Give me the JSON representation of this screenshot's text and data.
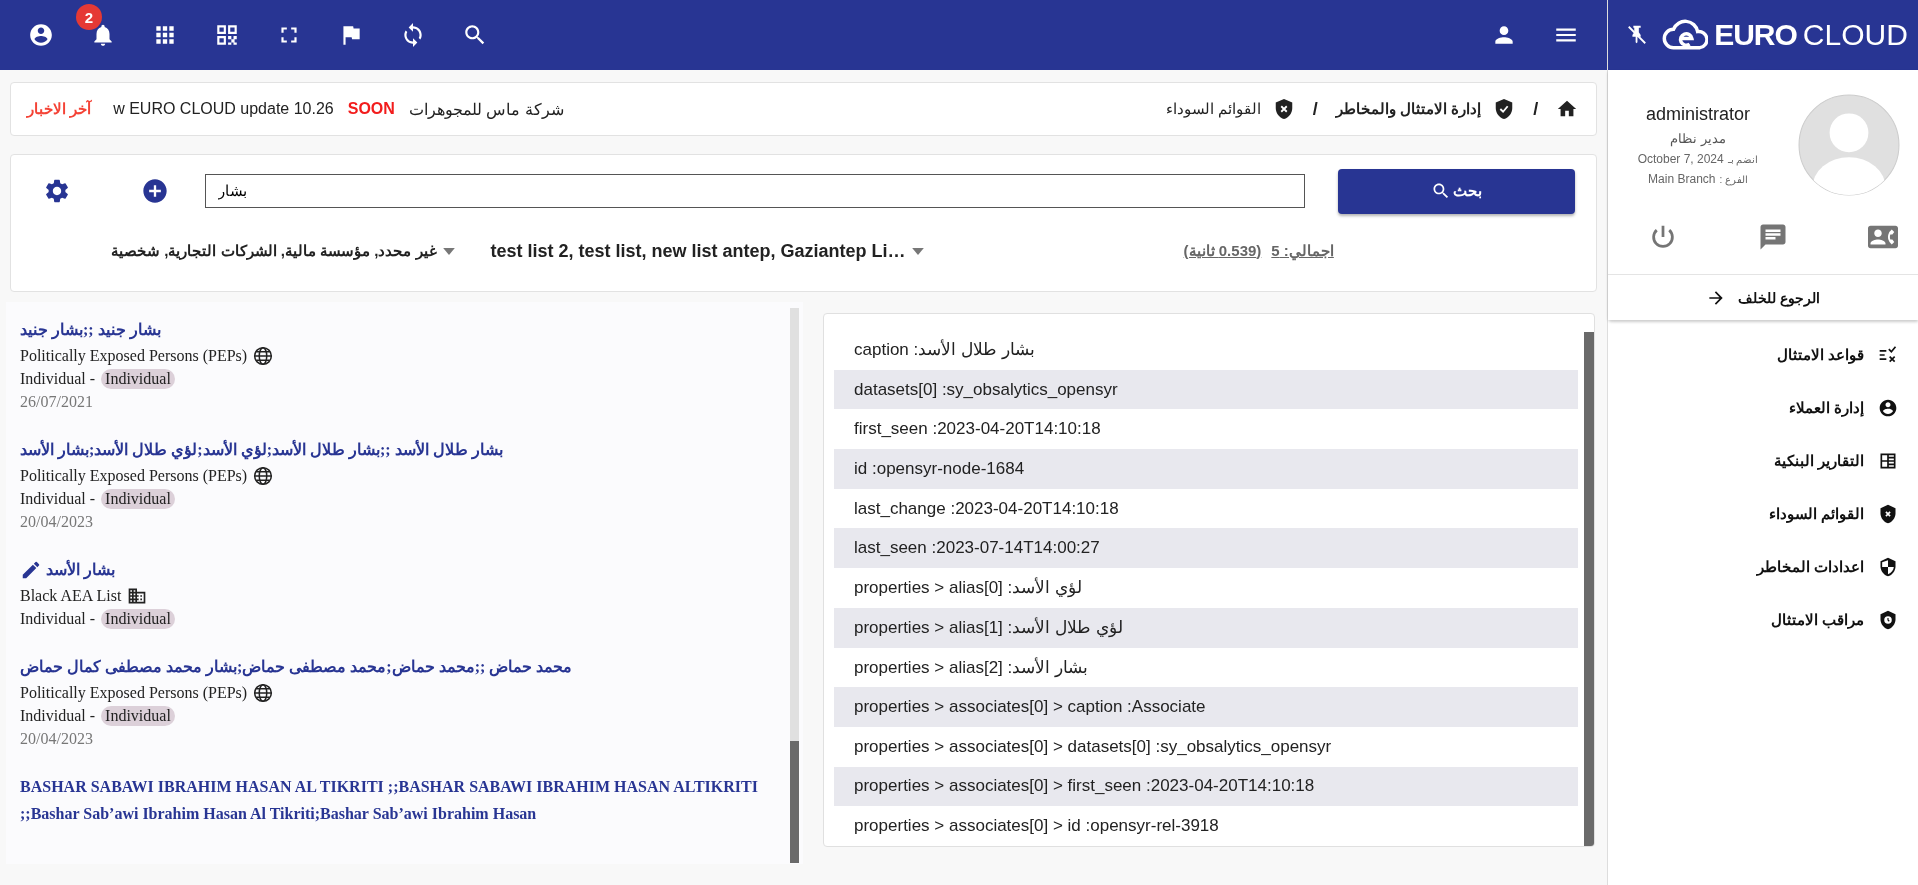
{
  "top_bar": {
    "notification_count": "2"
  },
  "news": {
    "label": "آخر الاخبار",
    "items": [
      {
        "text": "شركة ماس للمجوهرات",
        "highlight": false
      },
      {
        "text": "SOON",
        "highlight": true
      },
      {
        "text": "w EURO CLOUD update 10.26",
        "highlight": false
      }
    ]
  },
  "breadcrumb": [
    {
      "separator": "/",
      "label": "إدارة الامتثال والمخاطر",
      "current": false
    },
    {
      "separator": "/",
      "label": "القوائم السوداء",
      "current": true
    }
  ],
  "search": {
    "value": "بشار",
    "button": "بحث"
  },
  "filters": {
    "categories": "غير محدد, مؤسسة مالية, الشركات التجارية, شخصية",
    "lists": "test list 2, test list, new list antep, Gaziantep Li…",
    "total": "اجمالي: 5",
    "time": "(0.539 ثانية)"
  },
  "results": [
    {
      "title": "بشار جنيد ;;بشار جنيد",
      "editable": false,
      "source": "Politically Exposed Persons (PEPs)",
      "kind": "pep",
      "type": "Individual -",
      "badge": "Individual",
      "date": "26/07/2021"
    },
    {
      "title": "بشار طلال الأسد ;;بشار طلال الأسد;لؤي الأسد;لؤي طلال الأسد;بشار الأسد",
      "editable": false,
      "source": "Politically Exposed Persons (PEPs)",
      "kind": "pep",
      "type": "Individual -",
      "badge": "Individual",
      "date": "20/04/2023"
    },
    {
      "title": "بشار الأسد",
      "editable": true,
      "source": "Black AEA List",
      "kind": "blacklist",
      "type": "Individual -",
      "badge": "Individual"
    },
    {
      "title": "محمد حماض ;;محمد حماض;محمد مصطفى حماض;بشار محمد مصطفى كمال حماض",
      "editable": false,
      "source": "Politically Exposed Persons (PEPs)",
      "kind": "pep",
      "type": "Individual -",
      "badge": "Individual",
      "date": "20/04/2023"
    },
    {
      "title": "BASHAR SABAWI IBRAHIM HASAN AL TIKRITI ;;BASHAR SABAWI IBRAHIM HASAN ALTIKRITI ;;Bashar Sab’awi Ibrahim Hasan Al Tikriti;Bashar Sab’awi Ibrahim Hasan",
      "editable": false
    }
  ],
  "details": [
    "caption :بشار طلال الأسد",
    "datasets[0] :sy_obsalytics_opensyr",
    "first_seen :2023-04-20T14:10:18",
    "id :opensyr-node-1684",
    "last_change :2023-04-20T14:10:18",
    "last_seen :2023-07-14T14:00:27",
    "properties > alias[0] :لؤي الأسد",
    "properties > alias[1] :لؤي طلال الأسد",
    "properties > alias[2] :بشار الأسد",
    "properties > associates[0] > caption :Associate",
    "properties > associates[0] > datasets[0] :sy_obsalytics_opensyr",
    "properties > associates[0] > first_seen :2023-04-20T14:10:18",
    "properties > associates[0] > id :opensyr-rel-3918"
  ],
  "sidebar": {
    "logo": {
      "bold": "EURO",
      "light": "CLOUD"
    },
    "user": {
      "name": "administrator",
      "role": "مدير نظام",
      "joined_label": "انضم بـ",
      "joined": "October 7, 2024",
      "branch_label": "الفرع :",
      "branch": "Main Branch"
    },
    "back": "الرجوع للخلف",
    "nav": [
      {
        "label": "قواعد الامتثال",
        "kind": "rules"
      },
      {
        "label": "إدارة العملاء",
        "kind": "clients"
      },
      {
        "label": "التقارير البنكية",
        "kind": "reports"
      },
      {
        "label": "القوائم السوداء",
        "kind": "blacklists"
      },
      {
        "label": "اعدادات المخاطر",
        "kind": "risk"
      },
      {
        "label": "مراقب الامتثال",
        "kind": "monitor"
      }
    ]
  }
}
